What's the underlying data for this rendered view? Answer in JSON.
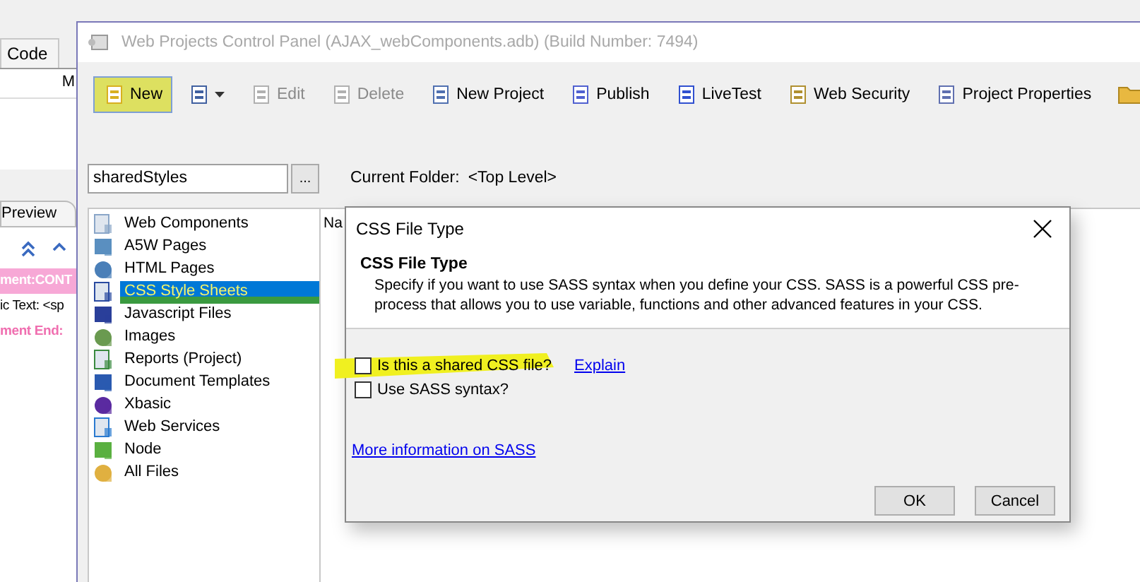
{
  "ide": {
    "tab": "Code",
    "field_text": "M",
    "preview_tab": "Preview",
    "lines": [
      {
        "text": "ment:CONT",
        "kind": "tag"
      },
      {
        "text": "ic Text: <sp",
        "kind": "plain"
      },
      {
        "text": "ment End:",
        "kind": "end"
      }
    ]
  },
  "window": {
    "title": "Web Projects Control Panel (AJAX_webComponents.adb) (Build Number: 7494)"
  },
  "toolbar": [
    {
      "kind": "button",
      "label": "New",
      "disabled": false,
      "highlighted": true
    },
    {
      "kind": "dropdown",
      "disabled": false,
      "highlighted": false
    },
    {
      "kind": "button",
      "label": "Edit",
      "disabled": true,
      "highlighted": false
    },
    {
      "kind": "button",
      "label": "Delete",
      "disabled": true,
      "highlighted": false
    },
    {
      "kind": "button",
      "label": "New Project",
      "disabled": false,
      "highlighted": false
    },
    {
      "kind": "button",
      "label": "Publish",
      "disabled": false,
      "highlighted": false
    },
    {
      "kind": "button",
      "label": "LiveTest",
      "disabled": false,
      "highlighted": false
    },
    {
      "kind": "button",
      "label": "Web Security",
      "disabled": false,
      "highlighted": false
    },
    {
      "kind": "button",
      "label": "Project Properties",
      "disabled": false,
      "highlighted": false
    },
    {
      "kind": "icon"
    }
  ],
  "folder": {
    "value": "sharedStyles",
    "browse": "...",
    "label": "Current Folder:",
    "current": "<Top Level>"
  },
  "categories": [
    {
      "label": "Web Components",
      "selected": false,
      "highlighted": false
    },
    {
      "label": "A5W Pages",
      "selected": false,
      "highlighted": false
    },
    {
      "label": "HTML Pages",
      "selected": false,
      "highlighted": false
    },
    {
      "label": "CSS Style Sheets",
      "selected": true,
      "highlighted": true
    },
    {
      "label": "Javascript Files",
      "selected": false,
      "highlighted": false
    },
    {
      "label": "Images",
      "selected": false,
      "highlighted": false
    },
    {
      "label": "Reports (Project)",
      "selected": false,
      "highlighted": false
    },
    {
      "label": "Document Templates",
      "selected": false,
      "highlighted": false
    },
    {
      "label": "Xbasic",
      "selected": false,
      "highlighted": false
    },
    {
      "label": "Web Services",
      "selected": false,
      "highlighted": false
    },
    {
      "label": "Node",
      "selected": false,
      "highlighted": false
    },
    {
      "label": "All Files",
      "selected": false,
      "highlighted": false
    }
  ],
  "file_list": {
    "header": "Na"
  },
  "dialog": {
    "title": "CSS File Type",
    "heading": "CSS File Type",
    "description": "Specify if you want to use SASS syntax when you define your CSS. SASS is a powerful CSS pre-process that allows you to use variable, functions and other advanced features in your CSS.",
    "options": [
      {
        "label": "Is this a shared CSS file?",
        "checked": false,
        "highlighted": true,
        "link": "Explain"
      },
      {
        "label": "Use SASS syntax?",
        "checked": false,
        "highlighted": false
      }
    ],
    "info_link": "More information on SASS",
    "buttons": [
      "OK",
      "Cancel"
    ]
  }
}
